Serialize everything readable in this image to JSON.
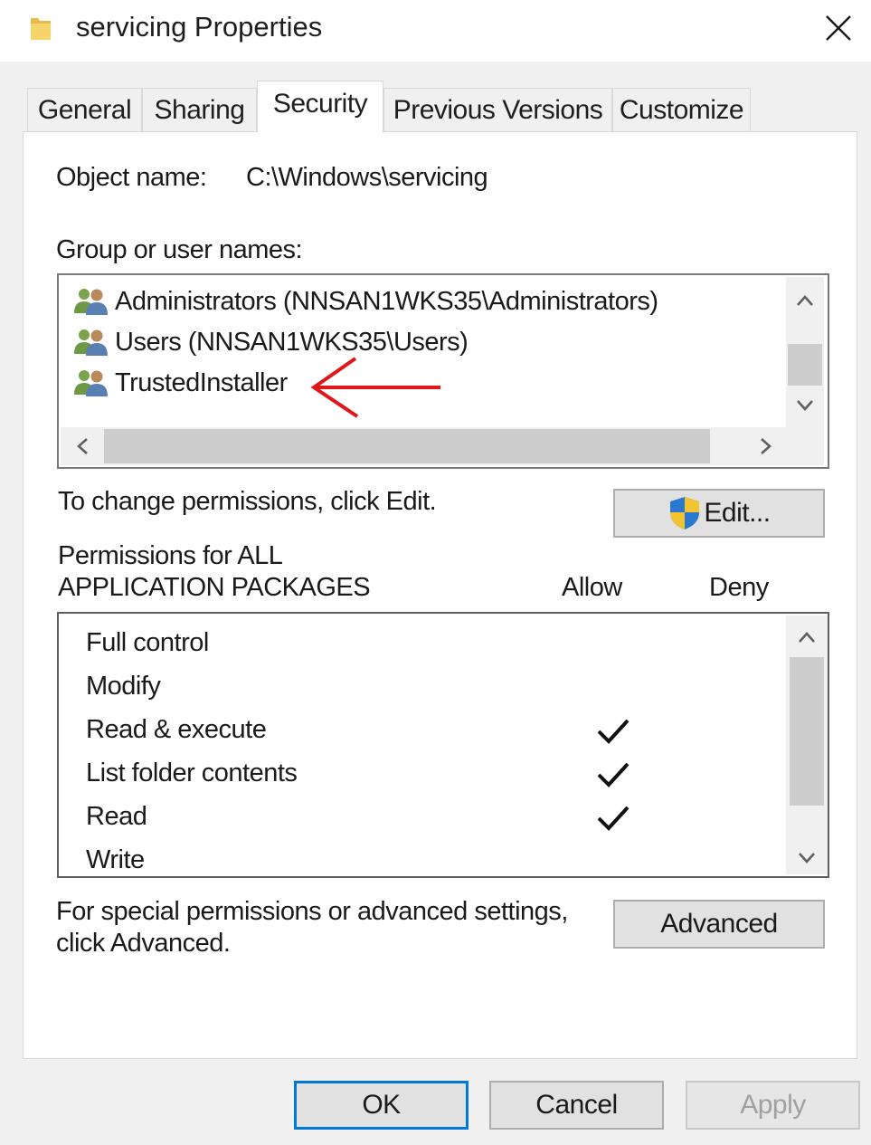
{
  "window": {
    "title": "servicing Properties",
    "close_glyph": "✕",
    "icon": "folder-icon"
  },
  "tabs": [
    {
      "label": "General",
      "active": false
    },
    {
      "label": "Sharing",
      "active": false
    },
    {
      "label": "Security",
      "active": true
    },
    {
      "label": "Previous Versions",
      "active": false
    },
    {
      "label": "Customize",
      "active": false
    }
  ],
  "security": {
    "object_name_label": "Object name:",
    "object_name_value": "C:\\Windows\\servicing",
    "group_label": "Group or user names:",
    "groups": [
      {
        "name": "Administrators (NNSAN1WKS35\\Administrators)",
        "icon": "users-icon"
      },
      {
        "name": "Users (NNSAN1WKS35\\Users)",
        "icon": "users-icon"
      },
      {
        "name": "TrustedInstaller",
        "icon": "users-icon"
      }
    ],
    "change_text": "To change permissions, click Edit.",
    "edit_button": "Edit...",
    "perm_header_line1": "Permissions for ALL",
    "perm_header_line2": "APPLICATION PACKAGES",
    "allow_header": "Allow",
    "deny_header": "Deny",
    "permissions": [
      {
        "name": "Full control",
        "allow": false,
        "deny": false
      },
      {
        "name": "Modify",
        "allow": false,
        "deny": false
      },
      {
        "name": "Read & execute",
        "allow": true,
        "deny": false
      },
      {
        "name": "List folder contents",
        "allow": true,
        "deny": false
      },
      {
        "name": "Read",
        "allow": true,
        "deny": false
      },
      {
        "name": "Write",
        "allow": false,
        "deny": false
      }
    ],
    "advanced_text_line1": "For special permissions or advanced settings,",
    "advanced_text_line2": "click Advanced.",
    "advanced_button": "Advanced"
  },
  "footer": {
    "ok": "OK",
    "cancel": "Cancel",
    "apply": "Apply",
    "apply_enabled": false
  },
  "colors": {
    "accent": "#0078d7",
    "annotation_arrow": "#e0161b",
    "dialog_bg": "#f0f0f0"
  }
}
